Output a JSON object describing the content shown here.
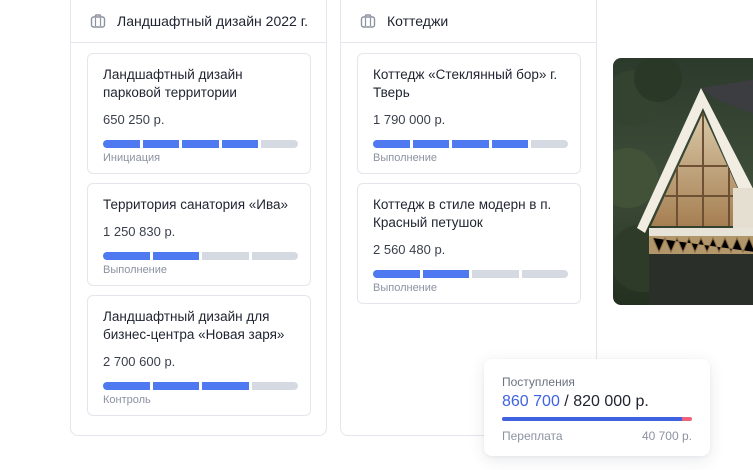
{
  "columns": [
    {
      "title": "Ландшафтный дизайн 2022 г.",
      "icon": "briefcase-icon",
      "cards": [
        {
          "title": "Ландшафтный дизайн парковой территории",
          "amount": "650 250 р.",
          "status": "Инициация",
          "progress_segments_done": 4,
          "progress_segments_total": 5
        },
        {
          "title": "Территория санатория «Ива»",
          "amount": "1 250 830 р.",
          "status": "Выполнение",
          "progress_segments_done": 2,
          "progress_segments_total": 4
        },
        {
          "title": "Ландшафтный дизайн для бизнес-центра «Новая заря»",
          "amount": "2 700 600 р.",
          "status": "Контроль",
          "progress_segments_done": 3,
          "progress_segments_total": 4
        }
      ]
    },
    {
      "title": "Коттеджи",
      "icon": "briefcase-icon",
      "cards": [
        {
          "title": "Коттедж «Стеклянный бор» г. Тверь",
          "amount": "1 790 000 р.",
          "status": "Выполнение",
          "progress_segments_done": 4,
          "progress_segments_total": 5
        },
        {
          "title": "Коттедж в стиле модерн в п. Красный петушок",
          "amount": "2 560 480 р.",
          "status": "Выполнение",
          "progress_segments_done": 2,
          "progress_segments_total": 4
        }
      ]
    }
  ],
  "photo": {
    "icon": "cottage-photo"
  },
  "summary": {
    "label": "Поступления",
    "received": "860 700",
    "separator": " / ",
    "planned": "820 000 р.",
    "overpay_label": "Переплата",
    "overpay_value": "40 700 р.",
    "received_fraction": 0.945
  },
  "colors": {
    "accent": "#4e79f0",
    "segment_empty": "#d5dae2",
    "overpay": "#f0627a"
  }
}
